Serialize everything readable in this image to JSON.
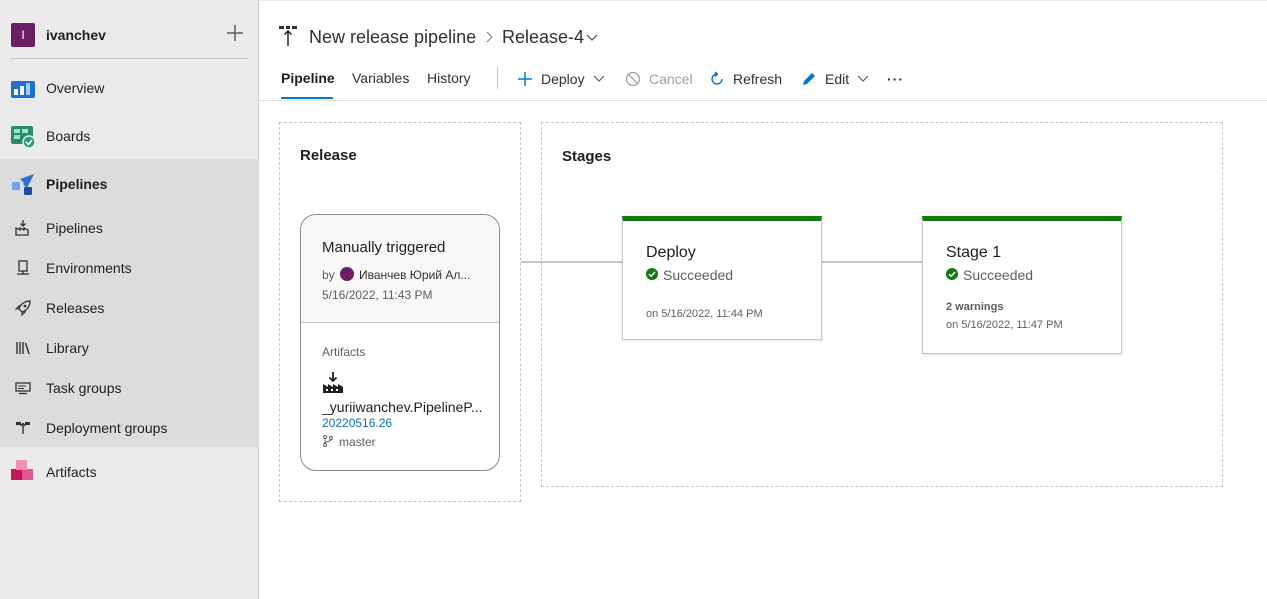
{
  "org": {
    "initial": "I",
    "name": "ivanchev"
  },
  "nav": {
    "overview": "Overview",
    "boards": "Boards",
    "pipelines": "Pipelines",
    "sub": [
      "Pipelines",
      "Environments",
      "Releases",
      "Library",
      "Task groups",
      "Deployment groups"
    ],
    "artifacts": "Artifacts"
  },
  "header": {
    "pipeline_name": "New release pipeline",
    "release_name": "Release-4",
    "tabs": [
      "Pipeline",
      "Variables",
      "History"
    ],
    "commands": {
      "deploy": "Deploy",
      "cancel": "Cancel",
      "refresh": "Refresh",
      "edit": "Edit",
      "more": "···"
    }
  },
  "release_panel": {
    "title": "Release",
    "trigger": "Manually triggered",
    "by_label": "by",
    "user": "Иванчев Юрий Ал...",
    "date": "5/16/2022, 11:43 PM",
    "artifacts_label": "Artifacts",
    "artifact_name": "_yuriiwanchev.PipelineP...",
    "build": "20220516.26",
    "branch": "master"
  },
  "stages_panel": {
    "title": "Stages",
    "stages": [
      {
        "name": "Deploy",
        "status": "Succeeded",
        "warnings": "",
        "date": "on 5/16/2022, 11:44 PM"
      },
      {
        "name": "Stage 1",
        "status": "Succeeded",
        "warnings": "2 warnings",
        "date": "on 5/16/2022, 11:47 PM"
      }
    ]
  },
  "colors": {
    "success": "#107c10",
    "accent": "#0078d4",
    "org": "#6b1e63"
  }
}
